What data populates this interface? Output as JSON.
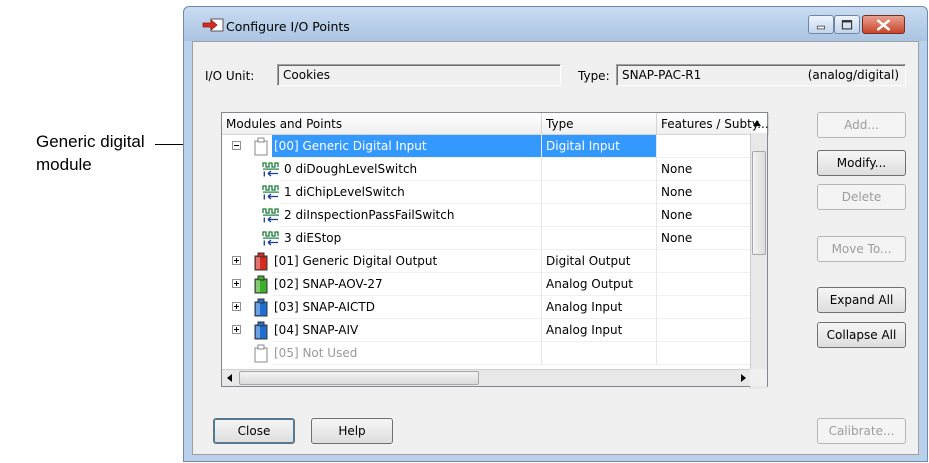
{
  "callout": {
    "line1": "Generic digital",
    "line2": "module"
  },
  "window": {
    "title": "Configure I/O Points"
  },
  "io_unit": {
    "label": "I/O Unit:",
    "value": "Cookies",
    "type_label": "Type:",
    "type_value": "SNAP-PAC-R1",
    "type_kind": "(analog/digital)"
  },
  "list": {
    "columns": [
      "Modules and Points",
      "Type",
      "Features / Subty..."
    ],
    "rows": [
      {
        "kind": "module",
        "expander": "minus",
        "icon": "generic-module-icon",
        "color": "#ffffff",
        "name": "[00] Generic Digital Input",
        "type": "Digital Input",
        "feature": "",
        "selected": true
      },
      {
        "kind": "point",
        "name": "0  diDoughLevelSwitch",
        "type": "",
        "feature": "None"
      },
      {
        "kind": "point",
        "name": "1  diChipLevelSwitch",
        "type": "",
        "feature": "None"
      },
      {
        "kind": "point",
        "name": "2  diInspectionPassFailSwitch",
        "type": "",
        "feature": "None"
      },
      {
        "kind": "point",
        "name": "3  diEStop",
        "type": "",
        "feature": "None"
      },
      {
        "kind": "module",
        "expander": "plus",
        "icon": "red-module-icon",
        "color": "#d42a1f",
        "name": "[01] Generic Digital Output",
        "type": "Digital Output",
        "feature": ""
      },
      {
        "kind": "module",
        "expander": "plus",
        "icon": "green-module-icon",
        "color": "#3fae2a",
        "name": "[02] SNAP-AOV-27",
        "type": "Analog Output",
        "feature": ""
      },
      {
        "kind": "module",
        "expander": "plus",
        "icon": "blue-module-icon",
        "color": "#1f6fd0",
        "name": "[03] SNAP-AICTD",
        "type": "Analog Input",
        "feature": ""
      },
      {
        "kind": "module",
        "expander": "plus",
        "icon": "blue-module-icon",
        "color": "#1f6fd0",
        "name": "[04] SNAP-AIV",
        "type": "Analog Input",
        "feature": ""
      },
      {
        "kind": "module",
        "expander": "none",
        "icon": "empty-slot-icon",
        "color": "#ffffff",
        "name": "[05] Not Used",
        "type": "",
        "feature": "",
        "disabled": true
      }
    ]
  },
  "buttons": {
    "add": "Add...",
    "modify": "Modify...",
    "delete": "Delete",
    "move_to": "Move To...",
    "expand_all": "Expand All",
    "collapse_all": "Collapse All",
    "close": "Close",
    "help": "Help",
    "calibrate": "Calibrate..."
  },
  "colors": {
    "selection": "#3399ff",
    "window_frame": "#b9d1ea",
    "close_button": "#c8452b"
  }
}
